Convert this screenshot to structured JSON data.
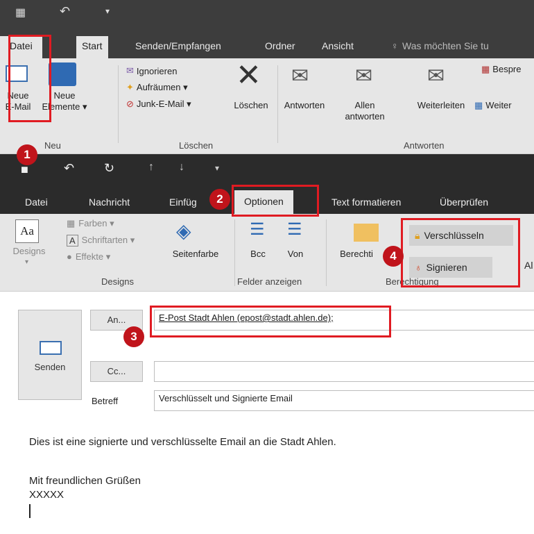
{
  "outer": {
    "tabs": [
      "Datei",
      "Start",
      "Senden/Empfangen",
      "Ordner",
      "Ansicht"
    ],
    "tell_me": "Was möchten Sie tu",
    "ribbon": {
      "new_mail": [
        "Neue",
        "E-Mail"
      ],
      "new_items": [
        "Neue",
        "Elemente ▾"
      ],
      "ignore": "Ignorieren",
      "cleanup": "Aufräumen ▾",
      "junk": "Junk-E-Mail ▾",
      "delete": "Löschen",
      "reply": "Antworten",
      "reply_all": [
        "Allen",
        "antworten"
      ],
      "forward": "Weiterleiten",
      "meeting": "Bespre",
      "more": "Weiter",
      "groups": [
        "Neu",
        "Löschen",
        "Antworten"
      ]
    }
  },
  "inner": {
    "tabs": [
      "Datei",
      "Nachricht",
      "Einfüg",
      "Optionen",
      "Text formatieren",
      "Überprüfen"
    ],
    "ribbon": {
      "designs": "Designs",
      "colors": "Farben ▾",
      "fonts": "Schriftarten ▾",
      "effects": "Effekte ▾",
      "page_color": "Seitenfarbe",
      "bcc": "Bcc",
      "from": "Von",
      "permission": "Berechti",
      "encrypt": "Verschlüsseln",
      "sign": "Signieren",
      "cut_off": "Al",
      "groups": [
        "Designs",
        "Felder anzeigen",
        "Berechtigung"
      ]
    }
  },
  "compose": {
    "send": "Senden",
    "to_label": "An...",
    "cc_label": "Cc...",
    "subject_label": "Betreff",
    "to_value": "E-Post Stadt Ahlen (epost@stadt.ahlen.de);",
    "cc_value": "",
    "subject_value": "Verschlüsselt und Signierte Email",
    "body": [
      "Dies ist eine signierte und verschlüsselte Email an die Stadt Ahlen.",
      "",
      "Mit freundlichen Grüßen",
      "XXXXX"
    ]
  },
  "callouts": [
    "1",
    "2",
    "3",
    "4"
  ],
  "colors": {
    "highlight": "#e01b22",
    "callout": "#c0141b",
    "dark": "#2b2b2b",
    "ribbon": "#e6e6e6"
  }
}
